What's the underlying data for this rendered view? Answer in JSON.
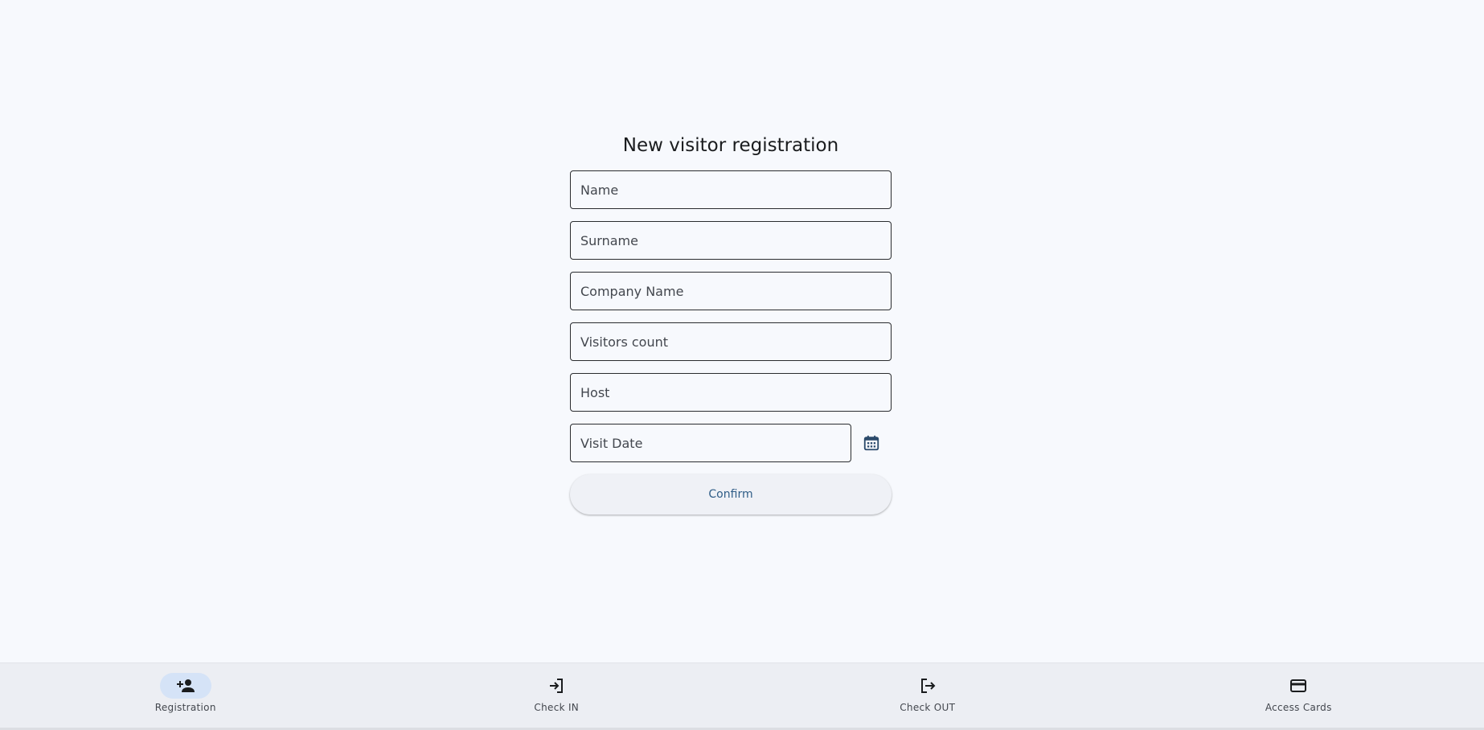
{
  "form": {
    "title": "New visitor registration",
    "fields": {
      "name": {
        "placeholder": "Name",
        "value": ""
      },
      "surname": {
        "placeholder": "Surname",
        "value": ""
      },
      "company": {
        "placeholder": "Company Name",
        "value": ""
      },
      "visitors_count": {
        "placeholder": "Visitors count",
        "value": ""
      },
      "host": {
        "placeholder": "Host",
        "value": ""
      },
      "visit_date": {
        "placeholder": "Visit Date",
        "value": ""
      }
    },
    "date_picker_icon": "calendar-icon",
    "confirm_label": "Confirm"
  },
  "bottom_nav": {
    "active": "Registration",
    "items": [
      {
        "label": "Registration",
        "icon": "person-add-icon"
      },
      {
        "label": "Check IN",
        "icon": "login-icon"
      },
      {
        "label": "Check OUT",
        "icon": "logout-icon"
      },
      {
        "label": "Access Cards",
        "icon": "credit-card-icon"
      }
    ]
  },
  "colors": {
    "background": "#f7f9fd",
    "nav_background": "#eceef3",
    "active_pill": "#d5e3f7",
    "accent": "#2f5d87",
    "calendar_icon": "#2b4a6b"
  }
}
